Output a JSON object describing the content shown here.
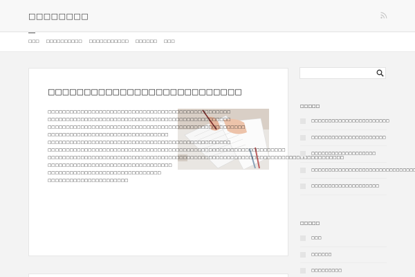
{
  "site": {
    "title": "□□□□□□□□"
  },
  "icons": {
    "rss": "rss-icon",
    "search": "search-icon",
    "list_item": "square-bullet-icon"
  },
  "nav": {
    "items": [
      {
        "label": "□□□"
      },
      {
        "label": "□□□□□□□□□□"
      },
      {
        "label": "□□□□□□□□□□□"
      },
      {
        "label": "□□□□□□"
      },
      {
        "label": "□□□"
      }
    ]
  },
  "article": {
    "title": "□□□□□□□□□□□□□□□□□□□□□□□□□□□",
    "paragraphs": [
      {
        "text": "□□□□□□□□□□□□□□□□□□□□□□□□□□□□□□□□□□□□□□□□□□□□□□□□□□",
        "width": "narrow"
      },
      {
        "text": "□□□□□□□□□□□□□□□□□□□□□□□□□□□□□□□□□□□□□□□□□□□□□□□□□□",
        "width": "narrow"
      },
      {
        "text": "□□□□□□□□□□□□□□□□□□□□□□□□□□□□□□□□□□□□□□□□□□□□□□□□□□□□□□",
        "width": "narrow"
      },
      {
        "text": "□□□□□□□□□□□□□□□□□□□□□□□□□□□□□□□□□",
        "width": "narrow"
      },
      {
        "text": "□□□□□□□□□□□□□□□□□□□□□□□□□□□□□□□□□□□□□□□□□□□□□□□□□□",
        "width": "narrow"
      },
      {
        "text": "□□□□□□□□□□□□□□□□□□□□□□□□□□□□□□□□□□□□□□□□□□□□□□□□□□□□□□□□□□□□□□□□□",
        "width": "narrow"
      },
      {
        "text": "□□□□□□□□□□□□□□□□□□□□□□□□□□□□□□□□□□□□□□□□□□□□□□□□□□□□□□□□□□□□□□□□□□□□□□□□□□□□□□□□□",
        "width": "wide"
      },
      {
        "text": "□□□□□□□□□□□□□□□□□□□□□□□□□□□□□□□□□□",
        "width": "wide"
      },
      {
        "text": "□□□□□□□□□□□□□□□□□□□□□□□□□□□□□□□",
        "width": "wide"
      },
      {
        "text": "□□□□□□□□□□□□□□□□□□□□□□",
        "width": "wide"
      }
    ]
  },
  "sidebar": {
    "search": {
      "placeholder": ""
    },
    "recent": {
      "title": "□□□□□",
      "items": [
        {
          "label": "□□□□□□□□□□□□□□□□□□□□□□□"
        },
        {
          "label": "□□□□□□□□□□□□□□□□□□□□□□"
        },
        {
          "label": "□□□□□□□□□□□□□□□□□□□"
        },
        {
          "label": "□□□□□□□□□□□□□□□□□□□□□□□□□□□□□□□□□"
        },
        {
          "label": "□□□□□□□□□□□□□□□□□□□□"
        }
      ]
    },
    "categories": {
      "title": "□□□□□",
      "items": [
        {
          "label": "□□□"
        },
        {
          "label": "□□□□□□"
        },
        {
          "label": "□□□□□□□□□"
        }
      ]
    }
  }
}
